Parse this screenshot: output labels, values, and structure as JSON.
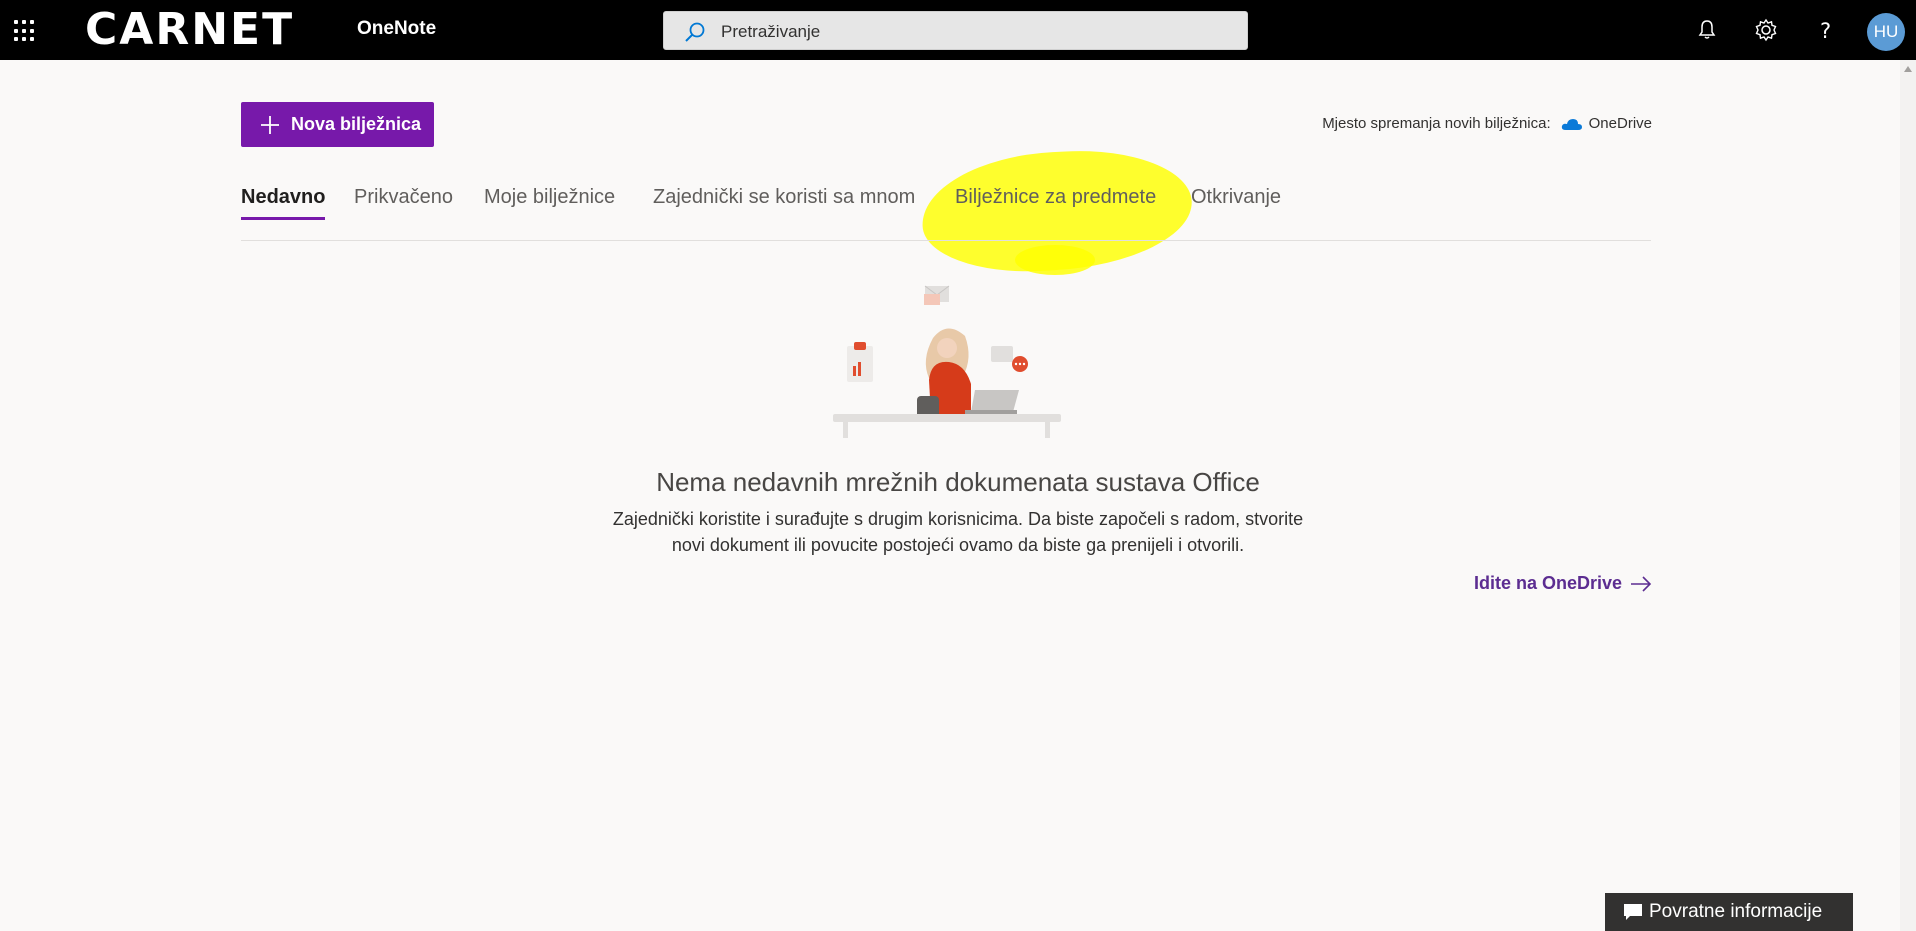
{
  "header": {
    "brand": "CARNET",
    "app_name": "OneNote",
    "search_placeholder": "Pretraživanje",
    "avatar_initials": "HU"
  },
  "toolbar": {
    "new_notebook_label": "Nova bilježnica",
    "save_location_label": "Mjesto spremanja novih bilježnica:",
    "save_location_value": "OneDrive"
  },
  "tabs": [
    {
      "label": "Nedavno",
      "active": true
    },
    {
      "label": "Prikvačeno",
      "active": false
    },
    {
      "label": "Moje bilježnice",
      "active": false
    },
    {
      "label": "Zajednički se koristi sa mnom",
      "active": false
    },
    {
      "label": "Bilježnice za predmete",
      "active": false
    },
    {
      "label": "Otkrivanje",
      "active": false
    }
  ],
  "empty_state": {
    "title": "Nema nedavnih mrežnih dokumenata sustava Office",
    "description_line1": "Zajednički koristite i surađujte s drugim korisnicima. Da biste započeli s radom, stvorite",
    "description_line2": "novi dokument ili povucite postojeći ovamo da biste ga prenijeli i otvorili.",
    "link_label": "Idite na OneDrive"
  },
  "feedback": {
    "label": "Povratne informacije"
  },
  "colors": {
    "accent": "#7719aa",
    "link": "#5c2d91",
    "topbar": "#000000",
    "highlight": "#ffff00",
    "avatar": "#5b9bd5"
  },
  "icons": [
    "app-launcher-icon",
    "search-icon",
    "bell-icon",
    "gear-icon",
    "help-icon",
    "plus-icon",
    "cloud-icon",
    "arrow-right-icon",
    "chat-icon"
  ]
}
